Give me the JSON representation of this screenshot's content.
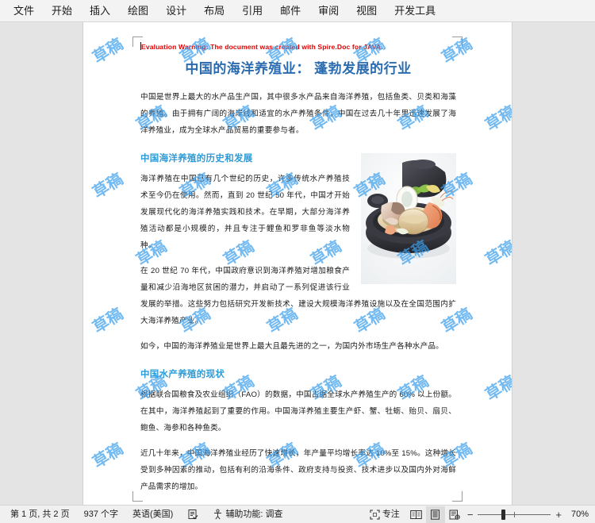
{
  "ribbon": {
    "menu_items": [
      {
        "label": "文件",
        "name": "menu-file"
      },
      {
        "label": "开始",
        "name": "menu-home"
      },
      {
        "label": "插入",
        "name": "menu-insert"
      },
      {
        "label": "绘图",
        "name": "menu-draw"
      },
      {
        "label": "设计",
        "name": "menu-design"
      },
      {
        "label": "布局",
        "name": "menu-layout"
      },
      {
        "label": "引用",
        "name": "menu-references"
      },
      {
        "label": "邮件",
        "name": "menu-mailings"
      },
      {
        "label": "审阅",
        "name": "menu-review"
      },
      {
        "label": "视图",
        "name": "menu-view"
      },
      {
        "label": "开发工具",
        "name": "menu-developer"
      }
    ]
  },
  "document": {
    "evaluation_warning": "Evaluation Warning: The document was created with Spire.Doc for JAVA.",
    "title": "中国的海洋养殖业： 蓬勃发展的行业",
    "title_color": "#2b6cb0",
    "heading_color": "#2e9bd6",
    "paragraph_1": "中国是世界上最大的水产品生产国，其中很多水产品来自海洋养殖，包括鱼类、贝类和海藻的养殖。由于拥有广阔的海岸线和适宜的水产养殖条件，中国在过去几十年里迅速发展了海洋养殖业，成为全球水产品贸易的重要参与者。",
    "heading_1": "中国海洋养殖的历史和发展",
    "paragraph_2": "海洋养殖在中国已有几个世纪的历史，许多传统水产养殖技术至今仍在使用。然而，直到 20 世纪 50 年代，中国才开始发展现代化的海洋养殖实践和技术。在早期，大部分海洋养殖活动都是小规模的，并且专注于鲤鱼和罗非鱼等淡水物种。",
    "paragraph_3": "在 20 世纪 70 年代，中国政府意识到海洋养殖对增加粮食产量和减少沿海地区贫困的潜力，并启动了一系列促进该行业发展的举措。这些努力包括研究开发新技术、建设大规模海洋养殖设施以及在全国范围内扩大海洋养殖产业。",
    "paragraph_4": "如今，中国的海洋养殖业是世界上最大且最先进的之一，为国内外市场生产各种水产品。",
    "heading_2": "中国水产养殖的现状",
    "paragraph_5": "根据联合国粮食及农业组织（FAO）的数据，中国占据全球水产养殖生产的 60% 以上份额。在其中，海洋养殖起到了重要的作用。中国海洋养殖主要生产虾、蟹、牡蛎、贻贝、扇贝、鲍鱼、海参和各种鱼类。",
    "paragraph_6": "近几十年来，中国海洋养殖业经历了快速增长，年产量平均增长率达 10%至 15%。这种增长受到多种因素的推动，包括有利的沿海条件、政府支持与投资、技术进步以及国内外对海鲜产品需求的增加。",
    "image_alt": "seafood-hotpot-photo",
    "watermark_text": "草稿",
    "watermark_color": "#3ca0eb"
  },
  "statusbar": {
    "page_info": "第 1 页, 共 2 页",
    "word_count": "937 个字",
    "language": "英语(美国)",
    "proofing_icon": "proofing-errors-icon",
    "accessibility_icon": "accessibility-icon",
    "accessibility_label": "辅助功能: 调查",
    "focus_icon": "focus-mode-icon",
    "focus_label": "专注",
    "view_read_icon": "read-mode-icon",
    "view_print_icon": "print-layout-icon",
    "view_web_icon": "web-layout-icon",
    "zoom_minus": "−",
    "zoom_plus": "+",
    "zoom_level": "70%"
  }
}
